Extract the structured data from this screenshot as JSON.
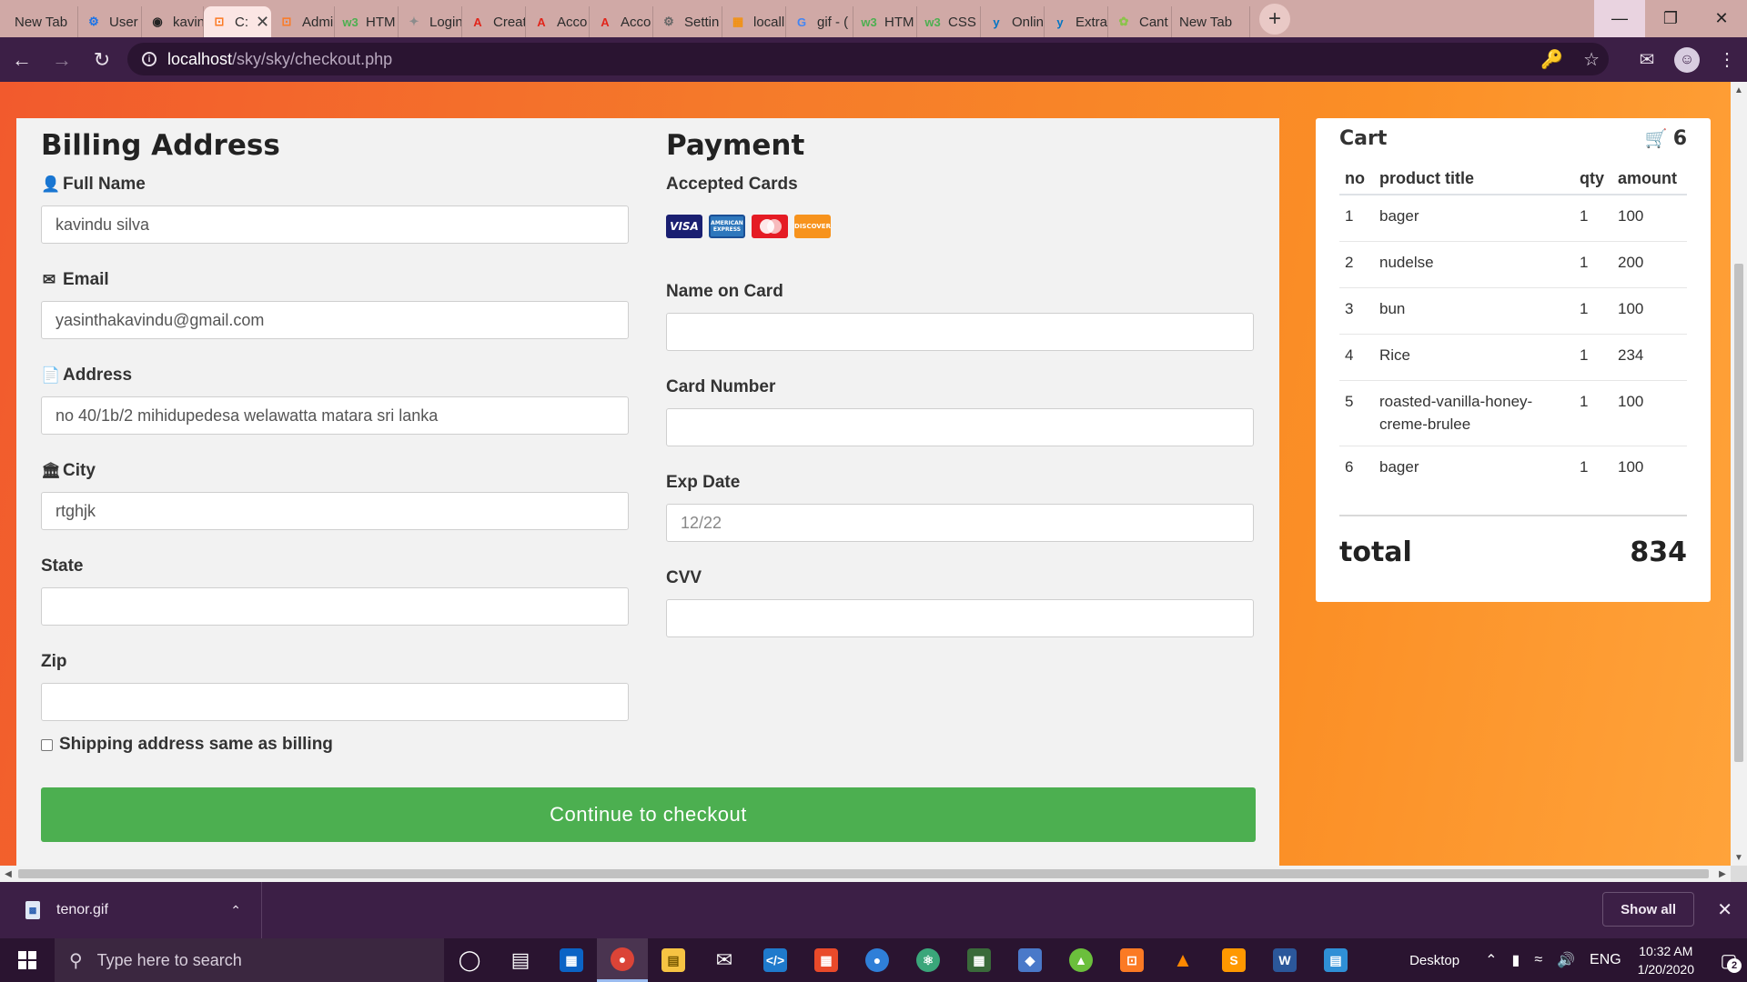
{
  "browser": {
    "tabs": [
      {
        "label": "New Tab",
        "icon": "none",
        "color": ""
      },
      {
        "label": "User",
        "icon": "gear-icon",
        "color": "#1a73e8"
      },
      {
        "label": "kavin",
        "icon": "github-icon",
        "color": "#222222"
      },
      {
        "label": "C:",
        "icon": "xampp-icon",
        "color": "#fb7a24",
        "active": true
      },
      {
        "label": "Admi",
        "icon": "xampp-icon",
        "color": "#fb7a24"
      },
      {
        "label": "HTM",
        "icon": "w3-icon",
        "color": "#4caf50"
      },
      {
        "label": "Login",
        "icon": "figma-icon",
        "color": "#8c8c8c"
      },
      {
        "label": "Creat",
        "icon": "adobe-icon",
        "color": "#e1251b"
      },
      {
        "label": "Acco",
        "icon": "adobe-icon",
        "color": "#e1251b"
      },
      {
        "label": "Acco",
        "icon": "adobe-icon",
        "color": "#e1251b"
      },
      {
        "label": "Settin",
        "icon": "settings-icon",
        "color": "#666666"
      },
      {
        "label": "locall",
        "icon": "phpmyadmin-icon",
        "color": "#f29111"
      },
      {
        "label": "gif - (",
        "icon": "google-icon",
        "color": "#4285f4"
      },
      {
        "label": "HTM",
        "icon": "w3-icon",
        "color": "#4caf50"
      },
      {
        "label": "CSS I",
        "icon": "w3-icon",
        "color": "#4caf50"
      },
      {
        "label": "Onlin",
        "icon": "yoast-icon",
        "color": "#0075c4"
      },
      {
        "label": "Extra",
        "icon": "yoast-icon",
        "color": "#0075c4"
      },
      {
        "label": "Cant",
        "icon": "leaf-icon",
        "color": "#8bc34a"
      },
      {
        "label": "New Tab",
        "icon": "none",
        "color": ""
      }
    ],
    "url_host": "localhost",
    "url_path": "/sky/sky/checkout.php"
  },
  "billing": {
    "title": "Billing Address",
    "fields": {
      "full_name": {
        "label": "Full Name",
        "value": "kavindu silva"
      },
      "email": {
        "label": "Email",
        "value": "yasinthakavindu@gmail.com"
      },
      "address": {
        "label": "Address",
        "value": "no 40/1b/2 mihidupedesa welawatta matara sri lanka"
      },
      "city": {
        "label": "City",
        "value": "rtghjk"
      },
      "state": {
        "label": "State",
        "value": ""
      },
      "zip": {
        "label": "Zip",
        "value": ""
      }
    },
    "shipping_same_label": "Shipping address same as billing",
    "shipping_same_checked": false
  },
  "payment": {
    "title": "Payment",
    "accepted_cards_label": "Accepted Cards",
    "cards": {
      "visa": "VISA",
      "amex": "AMERICAN EXPRESS",
      "discover": "DISCOVER"
    },
    "fields": {
      "name_on_card": {
        "label": "Name on Card",
        "value": ""
      },
      "card_number": {
        "label": "Card Number",
        "value": ""
      },
      "exp_date": {
        "label": "Exp Date",
        "value": "",
        "placeholder": "12/22"
      },
      "cvv": {
        "label": "CVV",
        "value": ""
      }
    }
  },
  "checkout_button": "Continue to checkout",
  "cart": {
    "title": "Cart",
    "count": "6",
    "columns": [
      "no",
      "product title",
      "qty",
      "amount"
    ],
    "rows": [
      {
        "no": "1",
        "title": "bager",
        "qty": "1",
        "amount": "100"
      },
      {
        "no": "2",
        "title": "nudelse",
        "qty": "1",
        "amount": "200"
      },
      {
        "no": "3",
        "title": "bun",
        "qty": "1",
        "amount": "100"
      },
      {
        "no": "4",
        "title": "Rice",
        "qty": "1",
        "amount": "234"
      },
      {
        "no": "5",
        "title": "roasted-vanilla-honey-creme-brulee",
        "qty": "1",
        "amount": "100"
      },
      {
        "no": "6",
        "title": "bager",
        "qty": "1",
        "amount": "100"
      }
    ],
    "total_label": "total",
    "total_value": "834"
  },
  "downloads": {
    "file_name": "tenor.gif",
    "show_all": "Show all"
  },
  "taskbar": {
    "search_placeholder": "Type here to search",
    "desktop_label": "Desktop",
    "language": "ENG",
    "time": "10:32 AM",
    "date": "1/20/2020",
    "notification_count": "2"
  }
}
